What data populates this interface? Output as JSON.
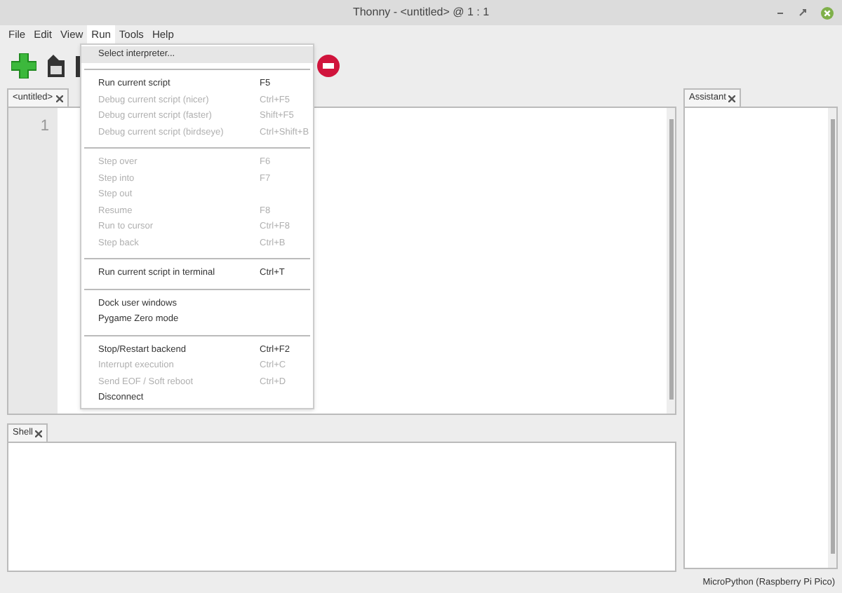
{
  "window": {
    "title": "Thonny - <untitled> @ 1 : 1"
  },
  "menu_bar": [
    {
      "label": "File",
      "selected": false
    },
    {
      "label": "Edit",
      "selected": false
    },
    {
      "label": "View",
      "selected": false
    },
    {
      "label": "Run",
      "selected": true
    },
    {
      "label": "Tools",
      "selected": false
    },
    {
      "label": "Help",
      "selected": false
    }
  ],
  "run_menu": [
    {
      "kind": "item",
      "label": "Select interpreter...",
      "selected": true,
      "disabled": false
    },
    {
      "kind": "separator"
    },
    {
      "kind": "item",
      "label": "Run current script",
      "shortcut": "F5",
      "selected": false,
      "disabled": false
    },
    {
      "kind": "item",
      "label": "Debug current script (nicer)",
      "shortcut": "Ctrl+F5",
      "selected": false,
      "disabled": true
    },
    {
      "kind": "item",
      "label": "Debug current script (faster)",
      "shortcut": "Shift+F5",
      "selected": false,
      "disabled": true
    },
    {
      "kind": "item",
      "label": "Debug current script (birdseye)",
      "shortcut": "Ctrl+Shift+B",
      "selected": false,
      "disabled": true
    },
    {
      "kind": "separator"
    },
    {
      "kind": "item",
      "label": "Step over",
      "shortcut": "F6",
      "selected": false,
      "disabled": true
    },
    {
      "kind": "item",
      "label": "Step into",
      "shortcut": "F7",
      "selected": false,
      "disabled": true
    },
    {
      "kind": "item",
      "label": "Step out",
      "selected": false,
      "disabled": true
    },
    {
      "kind": "item",
      "label": "Resume",
      "shortcut": "F8",
      "selected": false,
      "disabled": true
    },
    {
      "kind": "item",
      "label": "Run to cursor",
      "shortcut": "Ctrl+F8",
      "selected": false,
      "disabled": true
    },
    {
      "kind": "item",
      "label": "Step back",
      "shortcut": "Ctrl+B",
      "selected": false,
      "disabled": true
    },
    {
      "kind": "separator"
    },
    {
      "kind": "item",
      "label": "Run current script in terminal",
      "shortcut": "Ctrl+T",
      "selected": false,
      "disabled": false
    },
    {
      "kind": "separator"
    },
    {
      "kind": "item",
      "label": "Dock user windows",
      "selected": false,
      "disabled": false
    },
    {
      "kind": "item",
      "label": "Pygame Zero mode",
      "selected": false,
      "disabled": false
    },
    {
      "kind": "separator"
    },
    {
      "kind": "item",
      "label": "Stop/Restart backend",
      "shortcut": "Ctrl+F2",
      "selected": false,
      "disabled": false
    },
    {
      "kind": "item",
      "label": "Interrupt execution",
      "shortcut": "Ctrl+C",
      "selected": false,
      "disabled": true
    },
    {
      "kind": "item",
      "label": "Send EOF / Soft reboot",
      "shortcut": "Ctrl+D",
      "selected": false,
      "disabled": true
    },
    {
      "kind": "item",
      "label": "Disconnect",
      "selected": false,
      "disabled": false
    }
  ],
  "editor": {
    "tab": "<untitled>",
    "line_numbers": [
      "1"
    ]
  },
  "shell": {
    "tab": "Shell"
  },
  "assistant": {
    "tab": "Assistant"
  },
  "status_bar": "MicroPython (Raspberry Pi Pico)"
}
